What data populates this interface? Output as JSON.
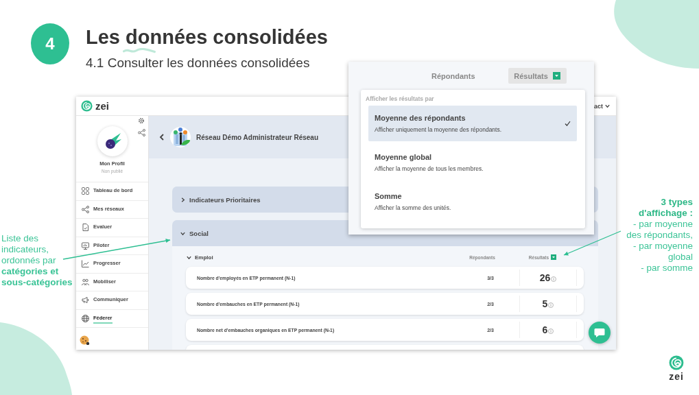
{
  "slide": {
    "step": "4",
    "title": "Les données consolidées",
    "subtitle": "4.1 Consulter les données consolidées",
    "footer_logo": "zei"
  },
  "app": {
    "brand": "zei",
    "account_menu": "act",
    "profile": {
      "name": "Mon Profil",
      "status": "Non publié"
    },
    "sidebar": {
      "items": [
        {
          "label": "Tableau de bord",
          "selected": false
        },
        {
          "label": "Mes réseaux",
          "selected": false
        },
        {
          "label": "Evaluer",
          "selected": false
        },
        {
          "label": "Piloter",
          "selected": false
        },
        {
          "label": "Progresser",
          "selected": false
        },
        {
          "label": "Mobiliser",
          "selected": false
        },
        {
          "label": "Communiquer",
          "selected": false
        },
        {
          "label": "Féderer",
          "selected": true
        }
      ]
    },
    "header": {
      "title": "Réseau Démo Administrateur Réseau"
    },
    "sections": [
      {
        "label": "Indicateurs Prioritaires",
        "expanded": false
      },
      {
        "label": "Social",
        "expanded": true,
        "subsections": [
          {
            "label": "Emploi",
            "expanded": true,
            "columns": [
              "Répondants",
              "Résultats"
            ],
            "rows": [
              {
                "name": "Nombre d'employés en ETP permanent (N-1)",
                "respondents": "3/3",
                "result": "26"
              },
              {
                "name": "Nombre d'embauches en ETP permanent (N-1)",
                "respondents": "2/3",
                "result": "5"
              },
              {
                "name": "Nombre net d'embauches organiques en ETP permanent (N-1)",
                "respondents": "2/3",
                "result": "6"
              }
            ]
          }
        ]
      }
    ]
  },
  "results_popover": {
    "columns": [
      "Répondants",
      "Résultats"
    ],
    "heading": "Afficher les résultats par",
    "options": [
      {
        "title": "Moyenne des répondants",
        "description": "Afficher uniquement la moyenne des répondants.",
        "selected": true
      },
      {
        "title": "Moyenne global",
        "description": "Afficher la moyenne de tous les membres.",
        "selected": false
      },
      {
        "title": "Somme",
        "description": "Afficher la somme des unités.",
        "selected": false
      }
    ]
  },
  "annotations": {
    "left": {
      "text": "Liste des indicateurs, ordonnés par **catégories et sous-catégories**"
    },
    "right": {
      "title": "3 types d'affichage :",
      "lines": [
        "- par moyenne des répondants,",
        "- par moyenne global",
        "- par  somme"
      ]
    }
  }
}
